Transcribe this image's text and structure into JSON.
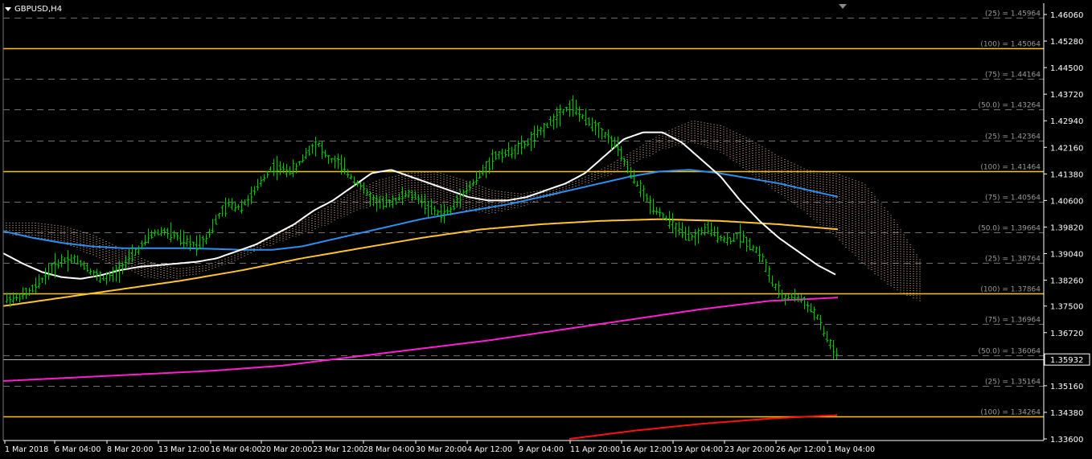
{
  "symbol_label": "GBPUSD,H4",
  "colors": {
    "background": "#000000",
    "bull_bar": "#00c800",
    "axis": "#ffffff",
    "level_major": "#ffc400",
    "level_minor": "#6e6e6e",
    "ma_white": "#ffffff",
    "ma_blue": "#2f8ff0",
    "ma_orange": "#ffc430",
    "ma_magenta": "#ff1fd0",
    "ma_red": "#ff1010",
    "cloud": "#ffc9a8",
    "current_price_line": "#b4b4b4"
  },
  "chart_data": {
    "type": "line",
    "title": "GBPUSD,H4",
    "current_price": "1.35932",
    "ylim": [
      1.36,
      1.465
    ],
    "y_ticks": [
      "1.46060",
      "1.45280",
      "1.44500",
      "1.43720",
      "1.42940",
      "1.42160",
      "1.41380",
      "1.40600",
      "1.39820",
      "1.39040",
      "1.38260",
      "1.37500",
      "1.36720",
      "1.35932",
      "1.35160",
      "1.34380",
      "1.33600"
    ],
    "x_ticks": [
      "1 Mar 2018",
      "6 Mar 04:00",
      "8 Mar 20:00",
      "13 Mar 12:00",
      "16 Mar 04:00",
      "20 Mar 20:00",
      "23 Mar 12:00",
      "28 Mar 04:00",
      "30 Mar 20:00",
      "4 Apr 12:00",
      "9 Apr 04:00",
      "11 Apr 20:00",
      "16 Apr 12:00",
      "19 Apr 04:00",
      "23 Apr 20:00",
      "26 Apr 12:00",
      "1 May 04:00"
    ],
    "levels": [
      {
        "label": "(25) = 1.45964",
        "price": 1.45964,
        "major": false
      },
      {
        "label": "(100) = 1.45064",
        "price": 1.45064,
        "major": true
      },
      {
        "label": "(75) = 1.44164",
        "price": 1.44164,
        "major": false
      },
      {
        "label": "(50.0) = 1.43264",
        "price": 1.43264,
        "major": false
      },
      {
        "label": "(25) = 1.42364",
        "price": 1.42364,
        "major": false
      },
      {
        "label": "(100) = 1.41464",
        "price": 1.41464,
        "major": true
      },
      {
        "label": "(75) = 1.40564",
        "price": 1.40564,
        "major": false
      },
      {
        "label": "(50.0) = 1.39664",
        "price": 1.39664,
        "major": false
      },
      {
        "label": "(25) = 1.38764",
        "price": 1.38764,
        "major": false
      },
      {
        "label": "(100) = 1.37864",
        "price": 1.37864,
        "major": true
      },
      {
        "label": "(75) = 1.36964",
        "price": 1.36964,
        "major": false
      },
      {
        "label": "(50.0) = 1.36064",
        "price": 1.36064,
        "major": false
      },
      {
        "label": "(25) = 1.35164",
        "price": 1.35164,
        "major": false
      },
      {
        "label": "(100) = 1.34264",
        "price": 1.34264,
        "major": true
      }
    ],
    "series": [
      {
        "color": "#00c800",
        "key": "price",
        "values": [
          1.377,
          1.3775,
          1.379,
          1.382,
          1.386,
          1.3885,
          1.389,
          1.387,
          1.384,
          1.383,
          1.385,
          1.389,
          1.392,
          1.396,
          1.397,
          1.396,
          1.394,
          1.393,
          1.395,
          1.401,
          1.405,
          1.404,
          1.407,
          1.412,
          1.416,
          1.415,
          1.415,
          1.42,
          1.423,
          1.418,
          1.417,
          1.413,
          1.41,
          1.406,
          1.405,
          1.406,
          1.408,
          1.407,
          1.404,
          1.402,
          1.403,
          1.408,
          1.411,
          1.415,
          1.419,
          1.42,
          1.421,
          1.423,
          1.426,
          1.429,
          1.432,
          1.434,
          1.43,
          1.428,
          1.425,
          1.422,
          1.415,
          1.41,
          1.405,
          1.402,
          1.399,
          1.396,
          1.395,
          1.398,
          1.396,
          1.394,
          1.396,
          1.393,
          1.39,
          1.382,
          1.377,
          1.378,
          1.376,
          1.372,
          1.365,
          1.3595
        ]
      },
      {
        "color": "#ffffff",
        "key": "ma_white",
        "values": [
          1.3905,
          1.3875,
          1.385,
          1.3835,
          1.383,
          1.384,
          1.3855,
          1.3865,
          1.387,
          1.3875,
          1.388,
          1.389,
          1.391,
          1.393,
          1.396,
          1.399,
          1.403,
          1.406,
          1.41,
          1.414,
          1.415,
          1.413,
          1.411,
          1.409,
          1.407,
          1.406,
          1.406,
          1.407,
          1.409,
          1.411,
          1.414,
          1.419,
          1.424,
          1.426,
          1.426,
          1.423,
          1.418,
          1.413,
          1.406,
          1.4,
          1.395,
          1.391,
          1.387,
          1.384
        ]
      },
      {
        "color": "#2f8ff0",
        "key": "ma_blue",
        "values": [
          1.397,
          1.395,
          1.3935,
          1.3925,
          1.392,
          1.392,
          1.392,
          1.3918,
          1.3915,
          1.3915,
          1.3925,
          1.3945,
          1.3965,
          1.3985,
          1.4005,
          1.402,
          1.4035,
          1.405,
          1.407,
          1.409,
          1.411,
          1.413,
          1.4145,
          1.415,
          1.414,
          1.4125,
          1.411,
          1.409,
          1.407
        ]
      },
      {
        "color": "#ffc430",
        "key": "ma_orange",
        "values": [
          1.375,
          1.3775,
          1.38,
          1.3825,
          1.3855,
          1.389,
          1.392,
          1.395,
          1.3975,
          1.399,
          1.4,
          1.4005,
          1.4,
          1.399,
          1.3975
        ]
      },
      {
        "color": "#ff1fd0",
        "key": "ma_magenta",
        "values": [
          1.353,
          1.354,
          1.355,
          1.356,
          1.3575,
          1.36,
          1.3625,
          1.365,
          1.368,
          1.371,
          1.374,
          1.3765,
          1.3775
        ]
      },
      {
        "color": "#ff1010",
        "key": "ma_red",
        "values": [
          1.336,
          1.3385,
          1.3405,
          1.342,
          1.343
        ]
      }
    ]
  }
}
